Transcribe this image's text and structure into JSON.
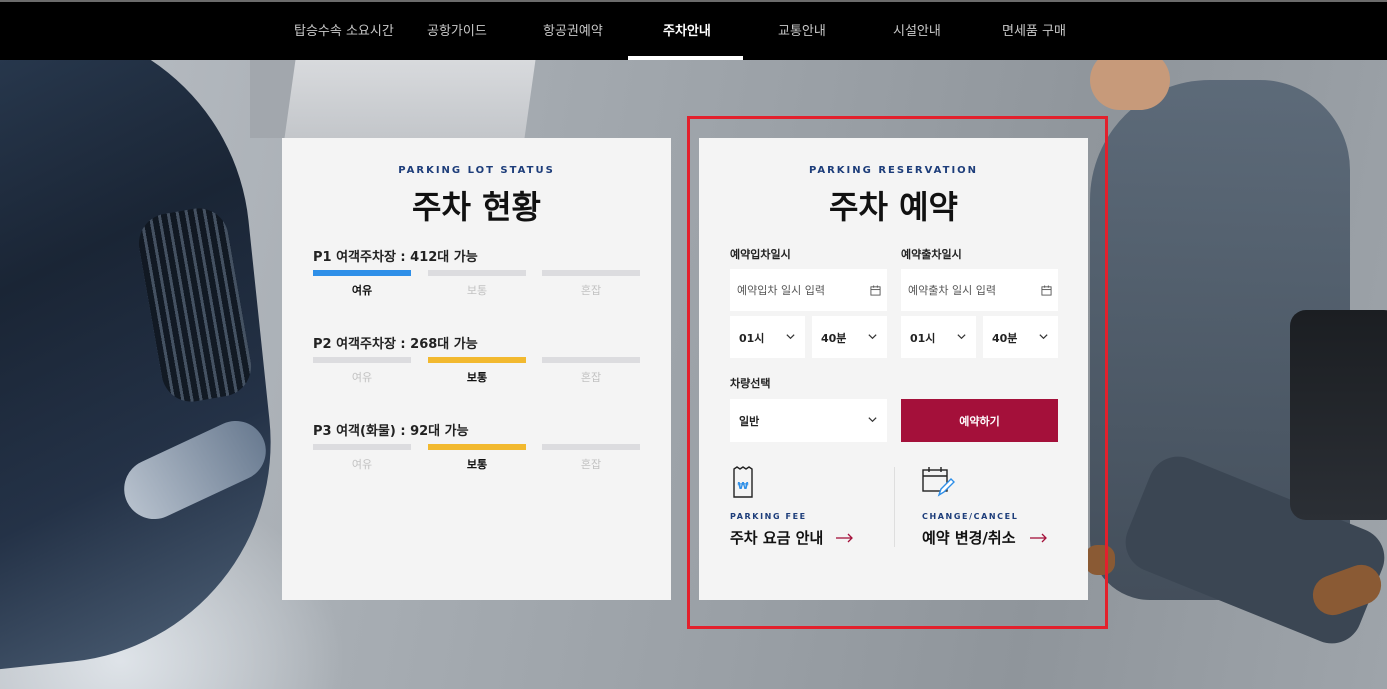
{
  "nav": {
    "items": [
      "탑승수속 소요시간",
      "공항가이드",
      "항공권예약",
      "주차안내",
      "교통안내",
      "시설안내",
      "면세품 구매"
    ],
    "active_index": 3
  },
  "status_card": {
    "eyebrow": "PARKING LOT STATUS",
    "title": "주차 현황",
    "levels": [
      "여유",
      "보통",
      "혼잡"
    ],
    "lots": [
      {
        "name": "P1 여객주차장 : 412대 가능",
        "level": "여유"
      },
      {
        "name": "P2 여객주차장 : 268대 가능",
        "level": "보통"
      },
      {
        "name": "P3 여객(화물) : 92대 가능",
        "level": "보통"
      }
    ]
  },
  "reservation_card": {
    "eyebrow": "PARKING RESERVATION",
    "title": "주차 예약",
    "entry_label": "예약입차일시",
    "exit_label": "예약출차일시",
    "entry_placeholder": "예약입차 일시 입력",
    "exit_placeholder": "예약출차 일시 입력",
    "entry_hour": "01시",
    "entry_minute": "40분",
    "exit_hour": "01시",
    "exit_minute": "40분",
    "vehicle_label": "차량선택",
    "vehicle_value": "일반",
    "reserve_button": "예약하기",
    "fee_link": {
      "eyebrow": "PARKING FEE",
      "label": "주차 요금 안내",
      "icon": "receipt-won-icon"
    },
    "change_link": {
      "eyebrow": "CHANGE/CANCEL",
      "label": "예약 변경/취소",
      "icon": "calendar-edit-icon"
    }
  },
  "colors": {
    "accent_red": "#a4103a",
    "highlight_border": "#e3202c",
    "level_blue": "#2e8fe8",
    "level_yellow": "#f2b92f",
    "eyebrow_navy": "#1d3d7a"
  }
}
